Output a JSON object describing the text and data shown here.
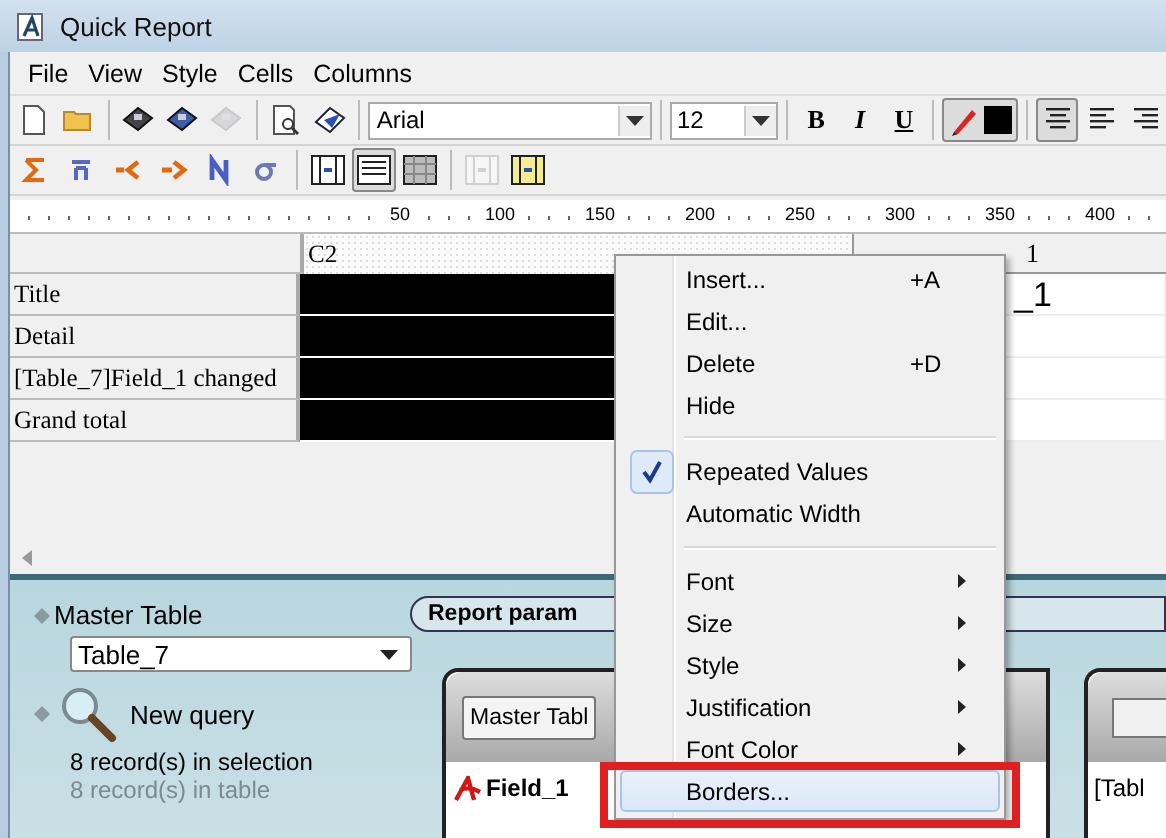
{
  "window": {
    "title": "Quick Report"
  },
  "menu_bar": [
    "File",
    "View",
    "Style",
    "Cells",
    "Columns"
  ],
  "toolbar_1": [
    {
      "kind": "new",
      "disabled": false
    },
    {
      "kind": "open",
      "disabled": false
    },
    {
      "kind": "sep"
    },
    {
      "kind": "save",
      "disabled": false
    },
    {
      "kind": "save-as",
      "disabled": false
    },
    {
      "kind": "print",
      "disabled": true
    },
    {
      "kind": "sep"
    },
    {
      "kind": "preview",
      "disabled": false
    },
    {
      "kind": "send",
      "disabled": false
    }
  ],
  "font_combo": {
    "value": "Arial"
  },
  "size_combo": {
    "value": "12"
  },
  "style_buttons": [
    {
      "label": "B",
      "kind": "bold"
    },
    {
      "label": "I",
      "kind": "italic"
    },
    {
      "label": "U",
      "kind": "underline"
    }
  ],
  "color_swatch": {
    "color": "#000000",
    "pressed": true
  },
  "align_buttons": [
    {
      "kind": "center",
      "pressed": true
    },
    {
      "kind": "left",
      "pressed": false
    },
    {
      "kind": "right",
      "pressed": false
    }
  ],
  "toolbar_2": [
    {
      "kind": "sum",
      "disabled": false
    },
    {
      "kind": "average",
      "disabled": false
    },
    {
      "kind": "min",
      "disabled": false
    },
    {
      "kind": "max",
      "disabled": false
    },
    {
      "kind": "count",
      "disabled": false
    },
    {
      "kind": "stddev",
      "disabled": false
    },
    {
      "kind": "sep"
    },
    {
      "kind": "cols",
      "pressed": false,
      "disabled": false
    },
    {
      "kind": "rows",
      "pressed": true,
      "disabled": false
    },
    {
      "kind": "pattern",
      "pressed": false,
      "disabled": false
    },
    {
      "kind": "sep"
    },
    {
      "kind": "insert-left",
      "pressed": false,
      "disabled": true
    },
    {
      "kind": "insert-right",
      "pressed": false,
      "disabled": false
    }
  ],
  "ruler": [
    "50",
    "100",
    "150",
    "200",
    "250",
    "300",
    "350",
    "400"
  ],
  "table": {
    "columns": [
      "C2",
      "1"
    ],
    "rows": [
      {
        "label": "Title",
        "cell_2": "_1"
      },
      {
        "label": "Detail",
        "cell_2": ""
      },
      {
        "label": "[Table_7]Field_1 changed",
        "cell_2": ""
      },
      {
        "label": "Grand total",
        "cell_2": ""
      }
    ]
  },
  "bottom_panel": {
    "master_table_label": "Master Table",
    "master_table_value": "Table_7",
    "new_query": "New query",
    "records_selection": "8 record(s) in selection",
    "records_table": "8 record(s) in table",
    "tab": "Report param",
    "inner_button": "Master Tabl",
    "field": "Field_1",
    "right_text": "[Tabl"
  },
  "context_menu": [
    {
      "kind": "item",
      "label": "Insert...",
      "shortcut": "+A",
      "checked": false,
      "submenu": false,
      "selected": false
    },
    {
      "kind": "item",
      "label": "Edit...",
      "checked": false,
      "submenu": false,
      "selected": false
    },
    {
      "kind": "item",
      "label": "Delete",
      "shortcut": "+D",
      "checked": false,
      "submenu": false,
      "selected": false
    },
    {
      "kind": "item",
      "label": "Hide",
      "checked": false,
      "submenu": false,
      "selected": false
    },
    {
      "kind": "separator"
    },
    {
      "kind": "item",
      "label": "Repeated Values",
      "checked": true,
      "submenu": false,
      "selected": false
    },
    {
      "kind": "item",
      "label": "Automatic Width",
      "checked": false,
      "submenu": false,
      "selected": false
    },
    {
      "kind": "separator"
    },
    {
      "kind": "item",
      "label": "Font",
      "checked": false,
      "submenu": true,
      "selected": false
    },
    {
      "kind": "item",
      "label": "Size",
      "checked": false,
      "submenu": true,
      "selected": false
    },
    {
      "kind": "item",
      "label": "Style",
      "checked": false,
      "submenu": true,
      "selected": false
    },
    {
      "kind": "item",
      "label": "Justification",
      "checked": false,
      "submenu": true,
      "selected": false
    },
    {
      "kind": "item",
      "label": "Font Color",
      "checked": false,
      "submenu": true,
      "selected": false
    },
    {
      "kind": "item",
      "label": "Borders...",
      "checked": false,
      "submenu": false,
      "selected": true
    }
  ],
  "highlight_frame": {
    "color": "#e02020"
  }
}
